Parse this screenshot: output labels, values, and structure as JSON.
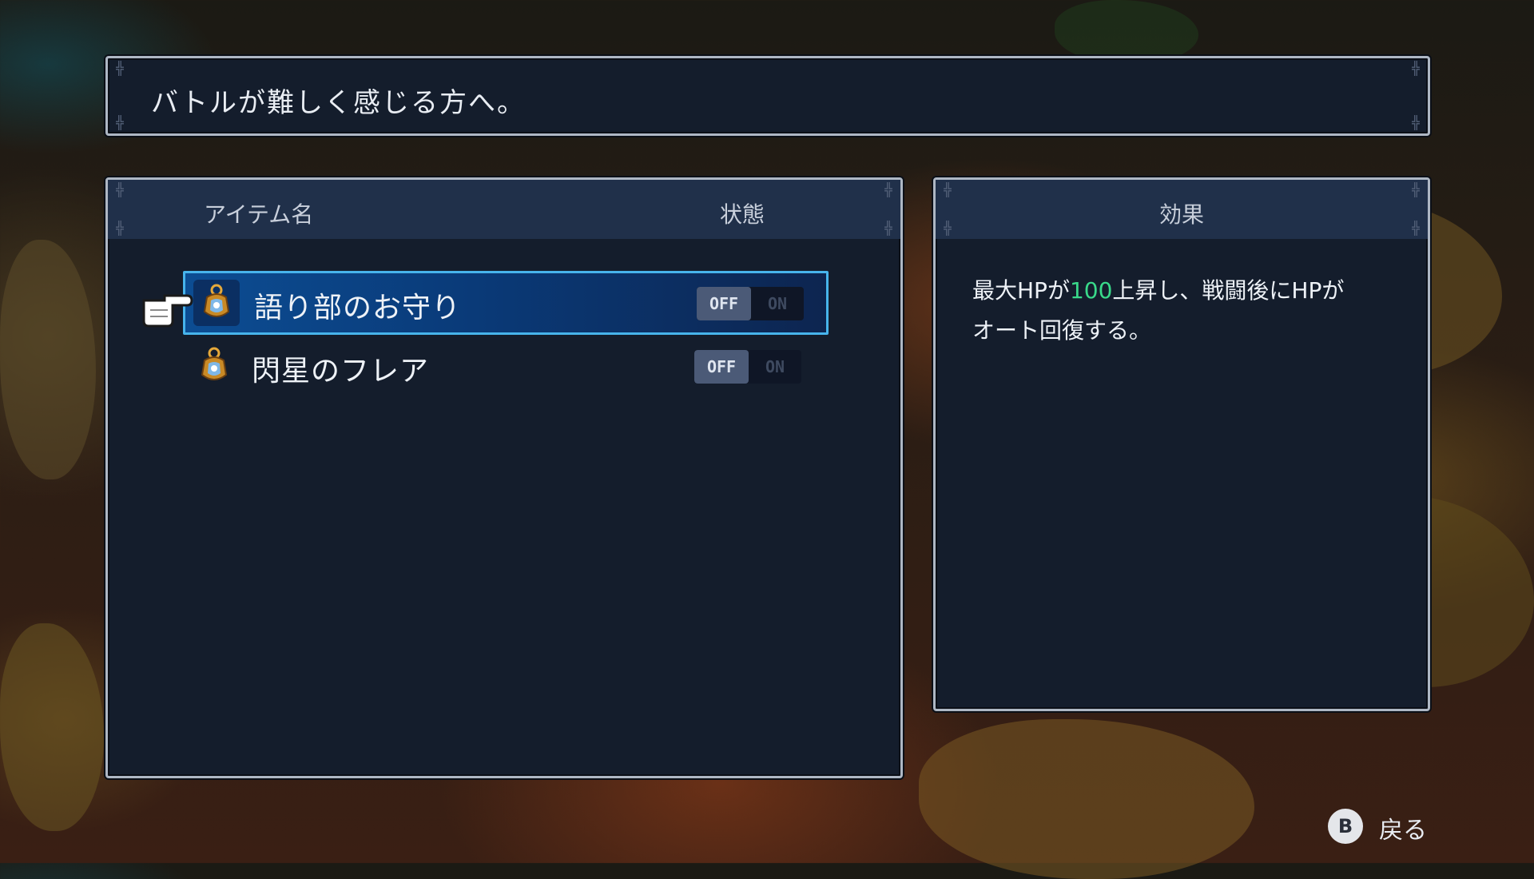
{
  "hint": {
    "text": "バトルが難しく感じる方へ。"
  },
  "list": {
    "header_name": "アイテム名",
    "header_status": "状態",
    "items": [
      {
        "name": "語り部のお守り",
        "off_label": "OFF",
        "on_label": "ON",
        "state": "OFF",
        "selected": true,
        "icon": "amulet-icon"
      },
      {
        "name": "閃星のフレア",
        "off_label": "OFF",
        "on_label": "ON",
        "state": "OFF",
        "selected": false,
        "icon": "amulet-icon"
      }
    ]
  },
  "effect": {
    "header": "効果",
    "text_part1": "最大HPが",
    "text_value": "100",
    "text_part2": "上昇し、戦闘後にHPが",
    "text_line2": "オート回復する。",
    "highlight_color": "#39d98a"
  },
  "footer": {
    "back_button_glyph": "B",
    "back_label": "戻る"
  },
  "colors": {
    "panel_bg": "#141d2c",
    "header_bg": "#20304a",
    "selection_border": "#47b4ec"
  }
}
